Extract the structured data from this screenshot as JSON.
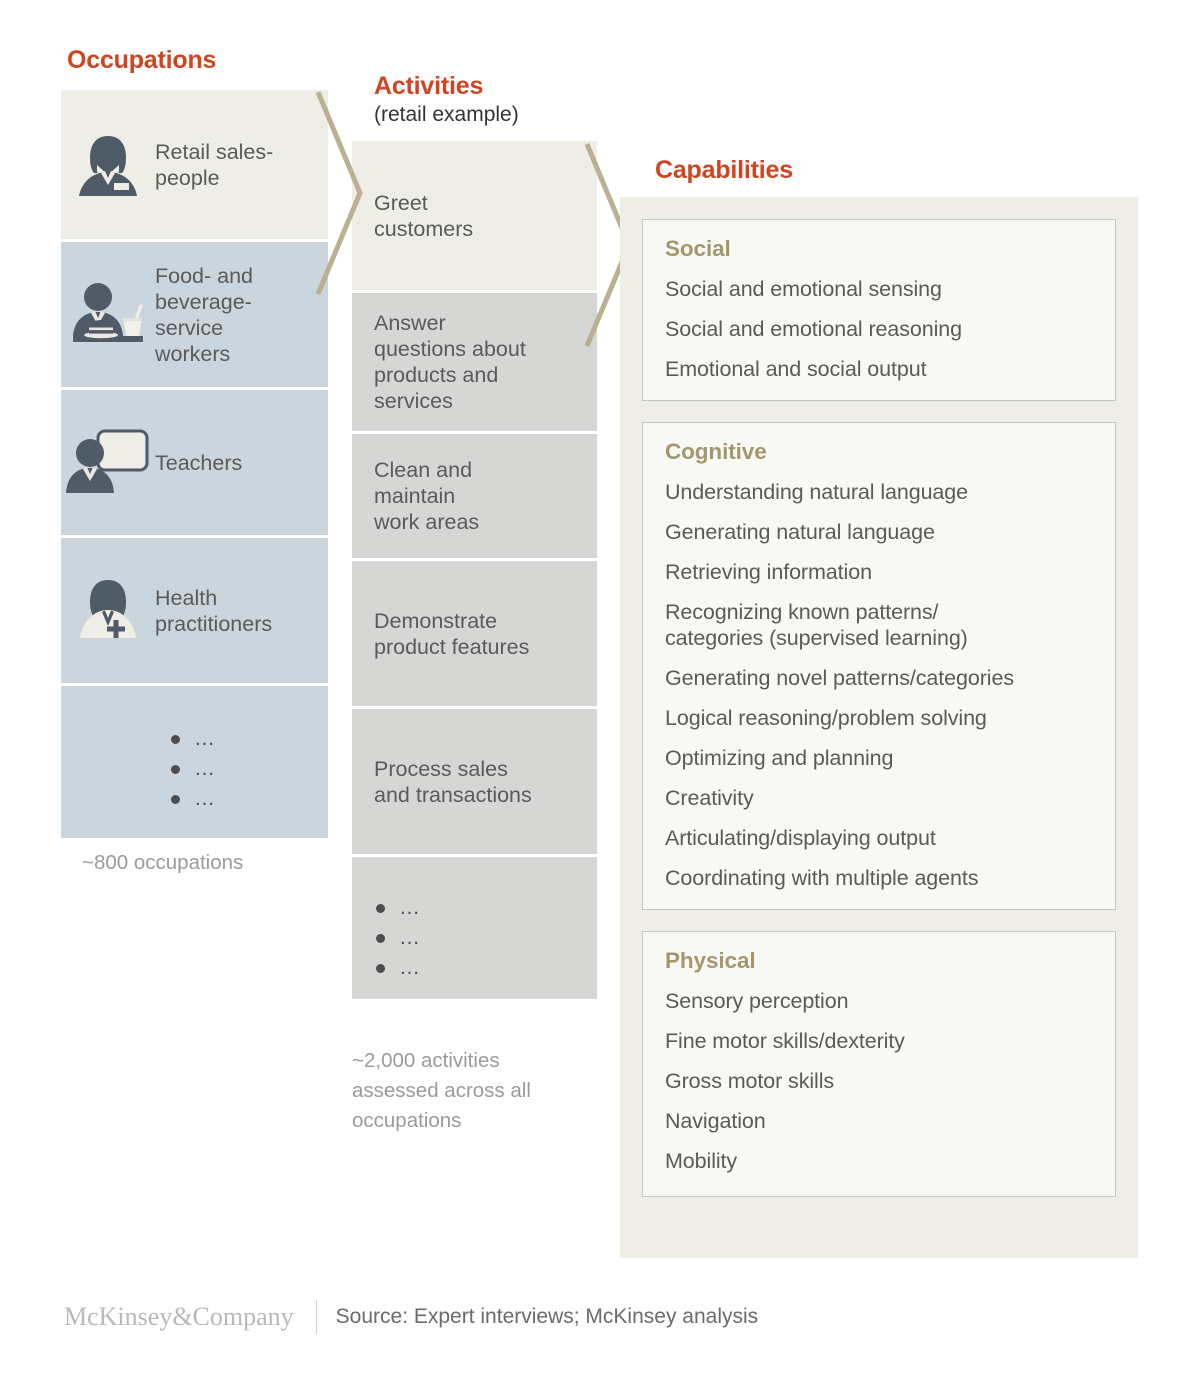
{
  "columns": {
    "occupations": {
      "title": "Occupations",
      "caption": "~800 occupations",
      "items": [
        {
          "label": "Retail sales-\npeople",
          "icon": "retail-salesperson-icon"
        },
        {
          "label": "Food- and\nbeverage-\nservice\nworkers",
          "icon": "food-beverage-worker-icon"
        },
        {
          "label": "Teachers",
          "icon": "teacher-icon"
        },
        {
          "label": "Health\npractitioners",
          "icon": "health-practitioner-icon"
        }
      ],
      "ellipsis_rows": [
        "…",
        "…",
        "…"
      ]
    },
    "activities": {
      "title": "Activities",
      "subtitle": "(retail example)",
      "caption": "~2,000 activities\nassessed across all\noccupations",
      "items": [
        {
          "label": "Greet\ncustomers",
          "highlighted": true
        },
        {
          "label": "Answer\nquestions about\nproducts and\nservices",
          "highlighted": false
        },
        {
          "label": "Clean and\nmaintain\nwork areas",
          "highlighted": false
        },
        {
          "label": "Demonstrate\nproduct features",
          "highlighted": false
        },
        {
          "label": "Process sales\nand transactions",
          "highlighted": false
        }
      ],
      "ellipsis_rows": [
        "…",
        "…",
        "…"
      ]
    },
    "capabilities": {
      "title": "Capabilities",
      "groups": [
        {
          "name": "Social",
          "items": [
            "Social and emotional sensing",
            "Social and emotional reasoning",
            "Emotional and social output"
          ]
        },
        {
          "name": "Cognitive",
          "items": [
            "Understanding natural language",
            "Generating natural language",
            "Retrieving information",
            "Recognizing known patterns/\ncategories (supervised learning)",
            "Generating novel patterns/categories",
            "Logical reasoning/problem solving",
            "Optimizing and planning",
            "Creativity",
            "Articulating/displaying output",
            "Coordinating with multiple agents"
          ]
        },
        {
          "name": "Physical",
          "items": [
            "Sensory perception",
            "Fine motor skills/dexterity",
            "Gross motor skills",
            "Navigation",
            "Mobility"
          ]
        }
      ]
    }
  },
  "footer": {
    "logo": "McKinsey&Company",
    "source": "Source: Expert interviews; McKinsey analysis"
  },
  "colors": {
    "accent_heading": "#cf4520",
    "capability_heading": "#a4976b",
    "chevron": "#bbb093",
    "occupation_highlight": "#eeeee6",
    "occupation_row": "#cbd5dd",
    "activity_highlight": "#eeeee6",
    "activity_row": "#d6d7d4",
    "panel_bg": "#eeeee6",
    "box_bg": "#f8f8f4",
    "body_text": "#5a5a5a",
    "caption_text": "#9b9b9b",
    "icon_figure": "#4f5b66"
  }
}
